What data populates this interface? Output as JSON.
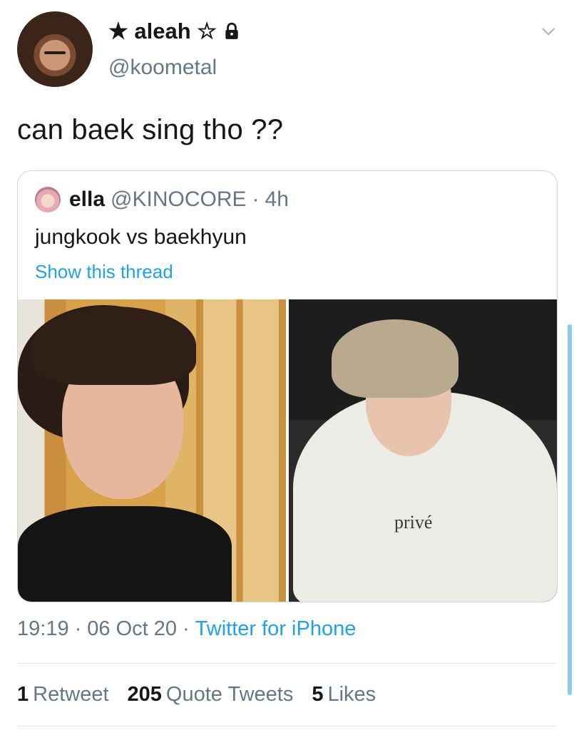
{
  "author": {
    "name": "★ aleah ☆",
    "handle": "@koometal"
  },
  "tweet": {
    "text": "can baek sing tho ??"
  },
  "quoted": {
    "name": "ella",
    "handle": "@KINOCORE",
    "separator": "·",
    "time": "4h",
    "text": "jungkook vs baekhyun",
    "thread_link": "Show this thread",
    "images": [
      {
        "print_text": ""
      },
      {
        "print_text": "privé"
      }
    ]
  },
  "meta": {
    "time": "19:19",
    "date": "06 Oct 20",
    "dot": "·",
    "source": "Twitter for iPhone"
  },
  "stats": {
    "retweets_count": "1",
    "retweets_label": "Retweet",
    "quotes_count": "205",
    "quotes_label": "Quote Tweets",
    "likes_count": "5",
    "likes_label": "Likes"
  },
  "icons": {
    "lock": "lock-icon",
    "chevron": "chevron-down-icon"
  },
  "colors": {
    "link": "#1da1f2",
    "secondary_text": "#657786",
    "border": "#ccd6dd"
  }
}
